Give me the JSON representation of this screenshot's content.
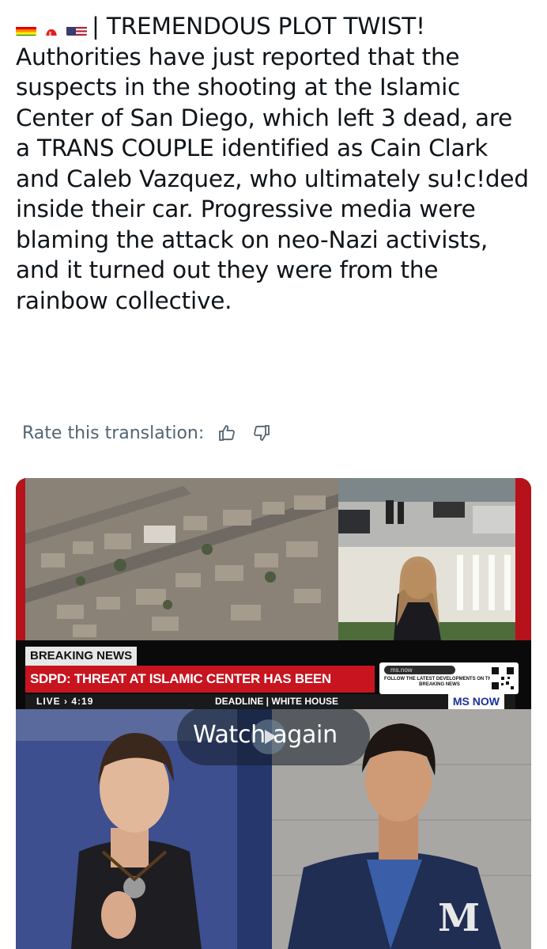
{
  "post": {
    "flags_prefix": "",
    "headline_start": "| TREMENDOUS PLOT TWIST!",
    "body": "Authorities have just reported that the suspects in the shooting at the Islamic Center of San Diego, which left 3 dead, are a TRANS COUPLE identified as Cain Clark and Caleb Vazquez, who ultimately su!c!ded inside their car. Progressive media were blaming the attack on neo-Nazi activists, and it turned out they were from the rainbow collective."
  },
  "rate": {
    "label": "Rate this translation:",
    "thumbs_up_icon": "thumbs-up-icon",
    "thumbs_down_icon": "thumbs-down-icon"
  },
  "video": {
    "breaking_tag": "BREAKING NEWS",
    "headline": "SDPD: THREAT AT ISLAMIC CENTER HAS BEEN NEUTRALIZED",
    "live": "LIVE",
    "time": "4:19",
    "show": "DEADLINE | WHITE HOUSE",
    "network": "MS NOW",
    "promo_handle": "ms.now",
    "promo_text": "FOLLOW THE LATEST DEVELOPMENTS ON THE BREAKING NEWS",
    "watch_again": "Watch again"
  },
  "colors": {
    "text": "#0f1419",
    "muted": "#536471",
    "breaking_red": "#c8141f",
    "network_blue": "#1b2f9a"
  }
}
